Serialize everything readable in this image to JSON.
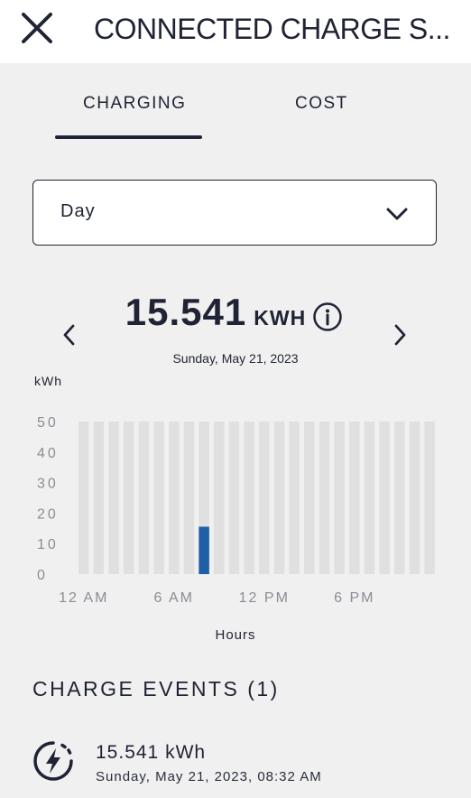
{
  "header": {
    "title": "CONNECTED CHARGE S...",
    "close_icon": "close-icon"
  },
  "tabs": [
    {
      "label": "CHARGING",
      "active": true
    },
    {
      "label": "COST",
      "active": false
    }
  ],
  "period_select": {
    "value": "Day",
    "icon": "chevron-down-icon"
  },
  "summary": {
    "total_value": "15.541",
    "unit": "KWH",
    "date": "Sunday, May 21, 2023"
  },
  "colors": {
    "accent": "#1e5fa8",
    "bar_background": "#e0e0e0",
    "text": "#1f2333"
  },
  "chart_data": {
    "type": "bar",
    "ylabel": "kWh",
    "xlabel": "Hours",
    "ylim": [
      0,
      50
    ],
    "y_ticks": [
      "50",
      "40",
      "30",
      "20",
      "10",
      "0"
    ],
    "x_tick_labels": [
      "12 AM",
      "6 AM",
      "12 PM",
      "6 PM"
    ],
    "categories": [
      "0",
      "1",
      "2",
      "3",
      "4",
      "5",
      "6",
      "7",
      "8",
      "9",
      "10",
      "11",
      "12",
      "13",
      "14",
      "15",
      "16",
      "17",
      "18",
      "19",
      "20",
      "21",
      "22",
      "23"
    ],
    "values": [
      0,
      0,
      0,
      0,
      0,
      0,
      0,
      0,
      15.541,
      0,
      0,
      0,
      0,
      0,
      0,
      0,
      0,
      0,
      0,
      0,
      0,
      0,
      0,
      0
    ]
  },
  "events": {
    "title": "CHARGE EVENTS (1)",
    "items": [
      {
        "value": "15.541 kWh",
        "date": "Sunday, May 21, 2023, 08:32 AM",
        "icon": "charging-bolt-icon"
      }
    ]
  }
}
